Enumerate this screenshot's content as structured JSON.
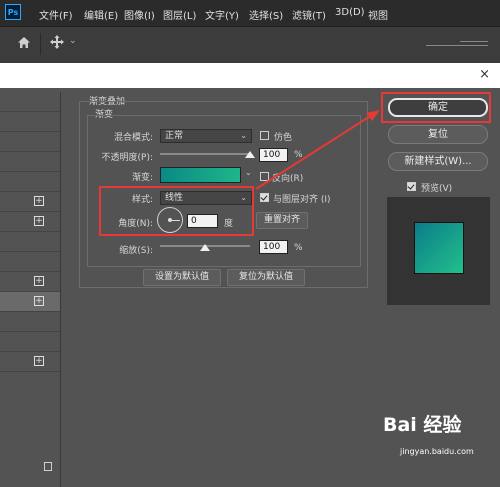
{
  "app": {
    "logo": "Ps"
  },
  "menu": [
    "文件(F)",
    "编辑(E)",
    "图像(I)",
    "图层(L)",
    "文字(Y)",
    "选择(S)",
    "滤镜(T)",
    "3D(D)",
    "视图"
  ],
  "options_bar": {
    "home_icon": "home-icon",
    "move_icon": "move-icon",
    "extra": "⌄"
  },
  "dialog": {
    "close": "×",
    "section_title": "渐变叠加",
    "group_title": "渐变",
    "blend_mode_label": "混合模式:",
    "blend_mode_value": "正常",
    "dither_label": "仿色",
    "opacity_label": "不透明度(P):",
    "opacity_value": "100",
    "opacity_unit": "%",
    "opacity_level": 1.0,
    "gradient_label": "渐变:",
    "reverse_label": "反向(R)",
    "style_label": "样式:",
    "style_value": "线性",
    "align_label": "与图层对齐 (I)",
    "angle_label": "角度(N):",
    "angle_value": "0",
    "angle_unit": "度",
    "reset_align_button": "重置对齐",
    "scale_label": "缩放(S):",
    "scale_value": "100",
    "scale_unit": "%",
    "scale_level": 0.5,
    "set_default_button": "设置为默认值",
    "reset_default_button": "复位为默认值",
    "ok_button": "确定",
    "reset_button": "复位",
    "new_style_button": "新建样式(W)...",
    "preview_label": "预览(V)",
    "gradient_colors": [
      "#0a8a86",
      "#1fb58a"
    ]
  },
  "watermark": {
    "brand": "Bai 经验",
    "url": "jingyan.baidu.com"
  }
}
